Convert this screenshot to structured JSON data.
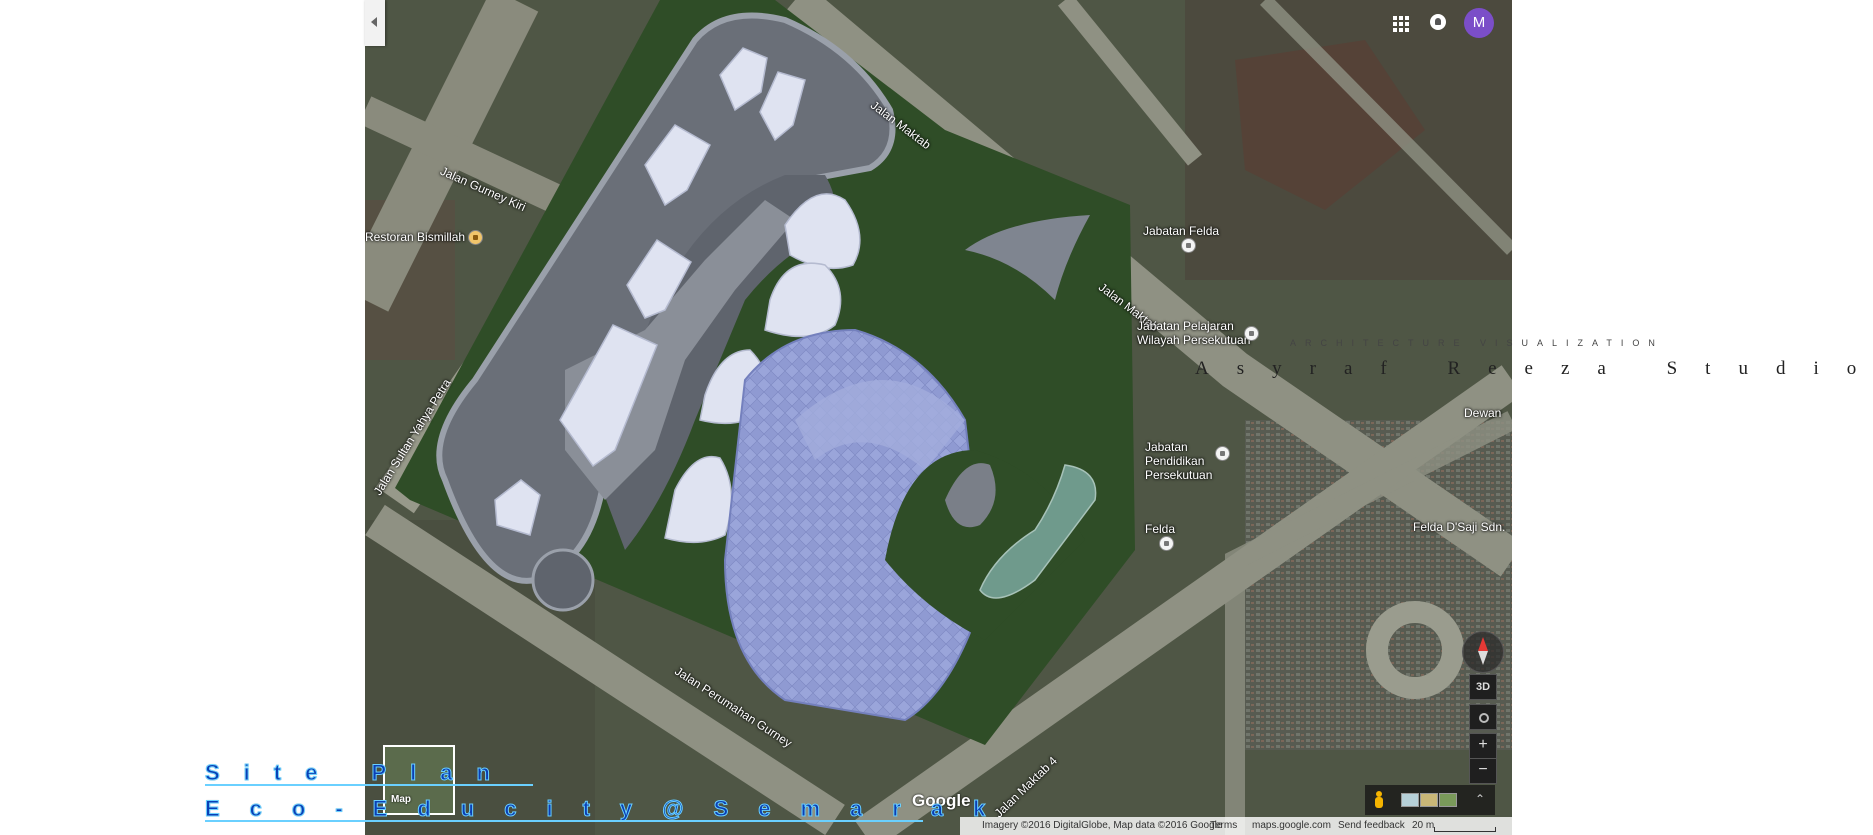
{
  "title": {
    "line1": "Site Plan",
    "line2": "Eco-Educity@Semarak"
  },
  "studio": {
    "subtitle": "ARCHITECTURE VISUALIZATION",
    "name": "Asyraf Reeza Studio"
  },
  "map": {
    "roads": [
      {
        "key": "jalan-maktab-1",
        "label": "Jalan Maktab"
      },
      {
        "key": "jalan-maktab-2",
        "label": "Jalan Maktab"
      },
      {
        "key": "jalan-gurney-kiri",
        "label": "Jalan Gurney Kiri"
      },
      {
        "key": "jalan-sultan-yahya-petra",
        "label": "Jalan Sultan Yahya Petra"
      },
      {
        "key": "jalan-perumahan-gurney",
        "label": "Jalan Perumahan Gurney"
      },
      {
        "key": "jalan-maktab-4",
        "label": "Jalan Maktab 4"
      }
    ],
    "places": {
      "bismillah": "Restoran Bismillah",
      "felda_top": "Jabatan Felda",
      "jabatan_pelajaran": "Jabatan Pelajaran Wilayah Persekutuan",
      "jabatan_pendidikan": "Jabatan Pendidikan Persekutuan",
      "felda_bottom": "Felda",
      "dewan": "Dewan",
      "felda_daji": "Felda D'Saji Sdn."
    },
    "colors": {
      "grass": "#2f4d27",
      "path": "#8d939b",
      "building": "#dfe3f1",
      "glass_roof": "#8f9ad2",
      "water": "#6f9a8c"
    }
  },
  "controls": {
    "btn_3d": "3D",
    "zoom_in": "+",
    "zoom_out": "−",
    "minimap_label": "Map",
    "avatar_letter": "M",
    "google_logo": "Google"
  },
  "footer": {
    "imagery": "Imagery ©2016 DigitalGlobe, Map data ©2016 Google",
    "terms": "Terms",
    "site": "maps.google.com",
    "feedback": "Send feedback",
    "scale": "20 m"
  }
}
